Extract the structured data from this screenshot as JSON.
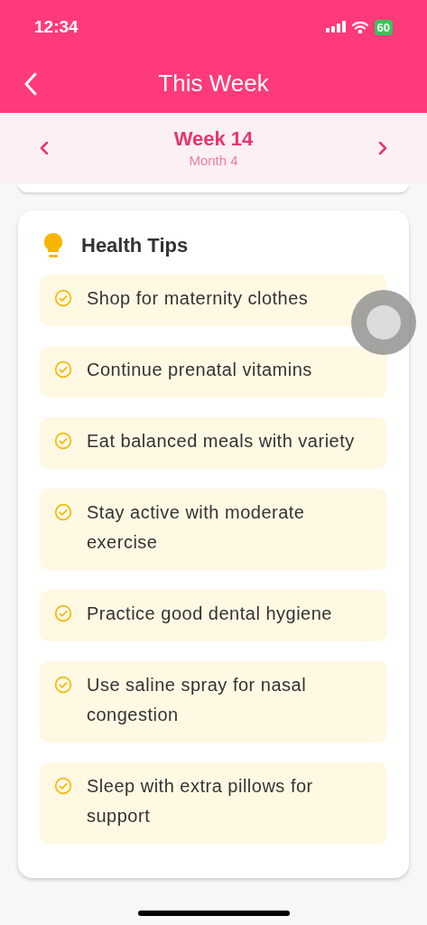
{
  "status_bar": {
    "time": "12:34",
    "battery": "60"
  },
  "header": {
    "title": "This Week"
  },
  "week_nav": {
    "week": "Week 14",
    "month": "Month 4"
  },
  "health_tips": {
    "title": "Health Tips",
    "items": [
      {
        "text": "Shop for maternity clothes"
      },
      {
        "text": "Continue prenatal vitamins"
      },
      {
        "text": "Eat balanced meals with variety"
      },
      {
        "text": "Stay active with moderate exercise"
      },
      {
        "text": "Practice good dental hygiene"
      },
      {
        "text": "Use saline spray for nasal congestion"
      },
      {
        "text": "Sleep with extra pillows for support"
      }
    ]
  }
}
